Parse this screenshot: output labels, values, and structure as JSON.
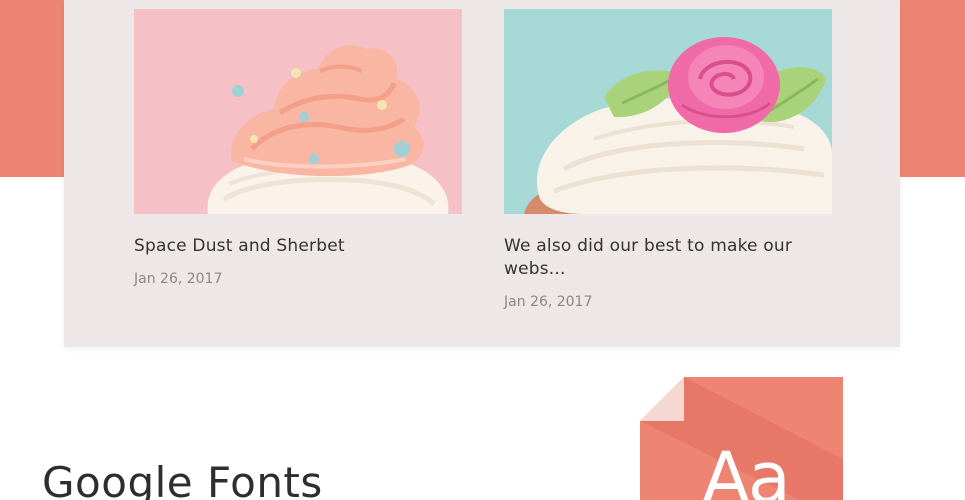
{
  "colors": {
    "accent": "#ee8472",
    "panel": "#ede7e7",
    "title": "#333333",
    "date": "#8d8787"
  },
  "posts": [
    {
      "title": "Space Dust and Sherbet",
      "date": "Jan 26, 2017",
      "image": "pink-frosting-cupcake"
    },
    {
      "title": "We also did our best to make our webs...",
      "date": "Jan 26, 2017",
      "image": "rose-topped-cupcake"
    }
  ],
  "google_fonts": {
    "heading": "Google Fonts",
    "icon": "font-file-icon",
    "icon_text": "Aa"
  }
}
